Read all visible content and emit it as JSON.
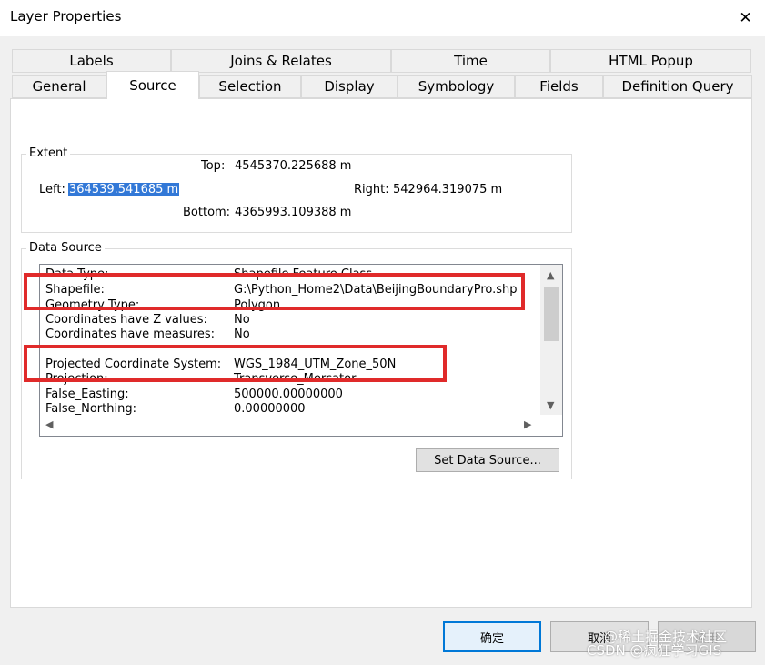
{
  "window": {
    "title": "Layer Properties",
    "close_glyph": "✕"
  },
  "tabs_row1": [
    "Labels",
    "Joins & Relates",
    "Time",
    "HTML Popup"
  ],
  "tabs_row2": [
    "General",
    "Source",
    "Selection",
    "Display",
    "Symbology",
    "Fields",
    "Definition Query"
  ],
  "active_tab": "Source",
  "extent": {
    "group_label": "Extent",
    "top_label": "Top:",
    "top_value": "4545370.225688 m",
    "left_label": "Left:",
    "left_value": "364539.541685 m",
    "right_label": "Right:",
    "right_value": "542964.319075 m",
    "bottom_label": "Bottom:",
    "bottom_value": "4365993.109388 m"
  },
  "data_source": {
    "group_label": "Data Source",
    "rows": [
      {
        "key": "Data Type:",
        "value": "Shapefile Feature Class"
      },
      {
        "key": "Shapefile:",
        "value": "G:\\Python_Home2\\Data\\BeijingBoundaryPro.shp"
      },
      {
        "key": "Geometry Type:",
        "value": "Polygon"
      },
      {
        "key": "Coordinates have Z values:",
        "value": "No"
      },
      {
        "key": "Coordinates have measures:",
        "value": "No"
      },
      {
        "key": "",
        "value": ""
      },
      {
        "key": "Projected Coordinate System:",
        "value": "WGS_1984_UTM_Zone_50N"
      },
      {
        "key": "Projection:",
        "value": "Transverse_Mercator"
      },
      {
        "key": "False_Easting:",
        "value": "500000.00000000"
      },
      {
        "key": "False_Northing:",
        "value": "0.00000000"
      }
    ],
    "set_button": "Set Data Source..."
  },
  "buttons": {
    "ok": "确定",
    "cancel": "取消",
    "apply": "应用"
  },
  "watermark": {
    "line1": "@稀土掘金技术社区",
    "line2": "CSDN @疯狂学习GIS"
  },
  "colors": {
    "selection": "#3278d7",
    "highlight_box": "#e02a2a"
  }
}
